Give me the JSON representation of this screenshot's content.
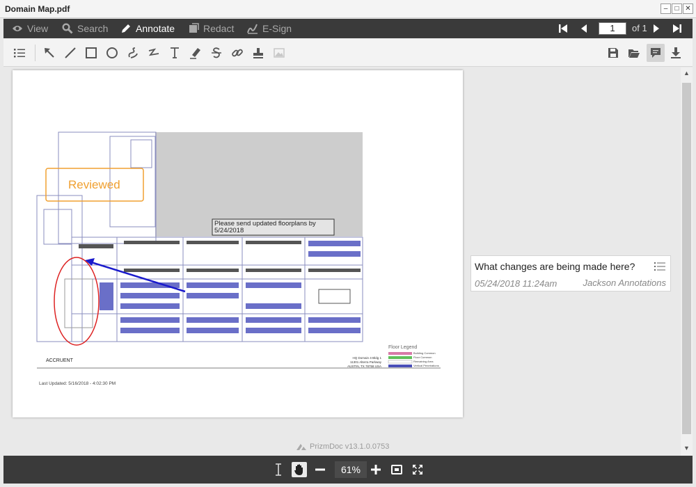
{
  "window": {
    "title": "Domain Map.pdf"
  },
  "tabs": [
    {
      "label": "View",
      "icon": "eye-icon"
    },
    {
      "label": "Search",
      "icon": "search-icon"
    },
    {
      "label": "Annotate",
      "icon": "pencil-icon",
      "active": true
    },
    {
      "label": "Redact",
      "icon": "redact-icon"
    },
    {
      "label": "E-Sign",
      "icon": "esign-icon"
    }
  ],
  "pager": {
    "current_page": "1",
    "of_label": "of 1"
  },
  "annotate_tools": [
    "thumbnails",
    "select",
    "line",
    "rectangle",
    "ellipse",
    "freehand",
    "polyline",
    "text",
    "highlight",
    "strikethrough",
    "link",
    "stamp",
    "image"
  ],
  "document": {
    "stamp_text": "Reviewed",
    "textbox_comment": "Please send updated floorplans by 5/24/2018",
    "footer_company": "ACCRUENT",
    "last_updated": "Last Updated: 5/16/2018 - 4:02:30 PM",
    "legend_title": "Floor Legend",
    "legend_items": [
      {
        "label": "Building Common",
        "color": "#d87aa8"
      },
      {
        "label": "Floor Common",
        "color": "#5fbf5a"
      },
      {
        "label": "Remaining Area",
        "color": "#ffffff"
      },
      {
        "label": "Vertical Penetrations",
        "color": "#4a4fb8"
      }
    ],
    "title_block": {
      "line1": "HQ Domain 4-Bldg 1",
      "line2": "11301 Alterra Parkway",
      "line3": "AUSTIN, TX 78758 USA"
    },
    "annotation_colors": {
      "stamp": "#f0a030",
      "ellipse": "#dd2222",
      "arrow": "#1a1acc"
    }
  },
  "comment": {
    "text": "What changes are being made here?",
    "date": "05/24/2018 11:24am",
    "author": "Jackson Annotations"
  },
  "branding": "PrizmDoc v13.1.0.0753",
  "zoom": {
    "value": "61%"
  }
}
